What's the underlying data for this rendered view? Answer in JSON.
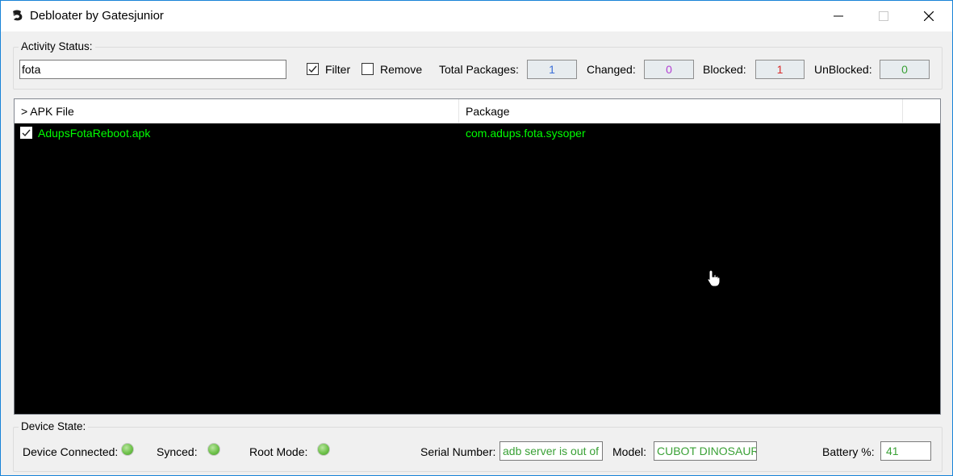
{
  "window": {
    "title": "Debloater by Gatesjunior"
  },
  "activity": {
    "group_label": "Activity Status:",
    "search_value": "fota",
    "filter_label": "Filter",
    "filter_checked": true,
    "remove_label": "Remove",
    "remove_checked": false,
    "total_label": "Total Packages:",
    "total_value": "1",
    "changed_label": "Changed:",
    "changed_value": "0",
    "blocked_label": "Blocked:",
    "blocked_value": "1",
    "unblocked_label": "UnBlocked:",
    "unblocked_value": "0"
  },
  "list": {
    "columns": [
      "> APK File",
      "Package"
    ],
    "rows": [
      {
        "checked": true,
        "apk": "AdupsFotaReboot.apk",
        "package": "com.adups.fota.sysoper"
      }
    ]
  },
  "device": {
    "group_label": "Device State:",
    "connected_label": "Device Connected:",
    "synced_label": "Synced:",
    "root_label": "Root Mode:",
    "serial_label": "Serial Number:",
    "serial_value": "adb server is out of date.  killing...",
    "model_label": "Model:",
    "model_value": "CUBOT DINOSAUR",
    "battery_label": "Battery %:",
    "battery_value": "41"
  },
  "colors": {
    "list_text": "#00ff00",
    "total_value": "#3b6fd8",
    "changed_value": "#b23fd3",
    "blocked_value": "#d92b2b",
    "unblocked_value": "#3aa136"
  }
}
